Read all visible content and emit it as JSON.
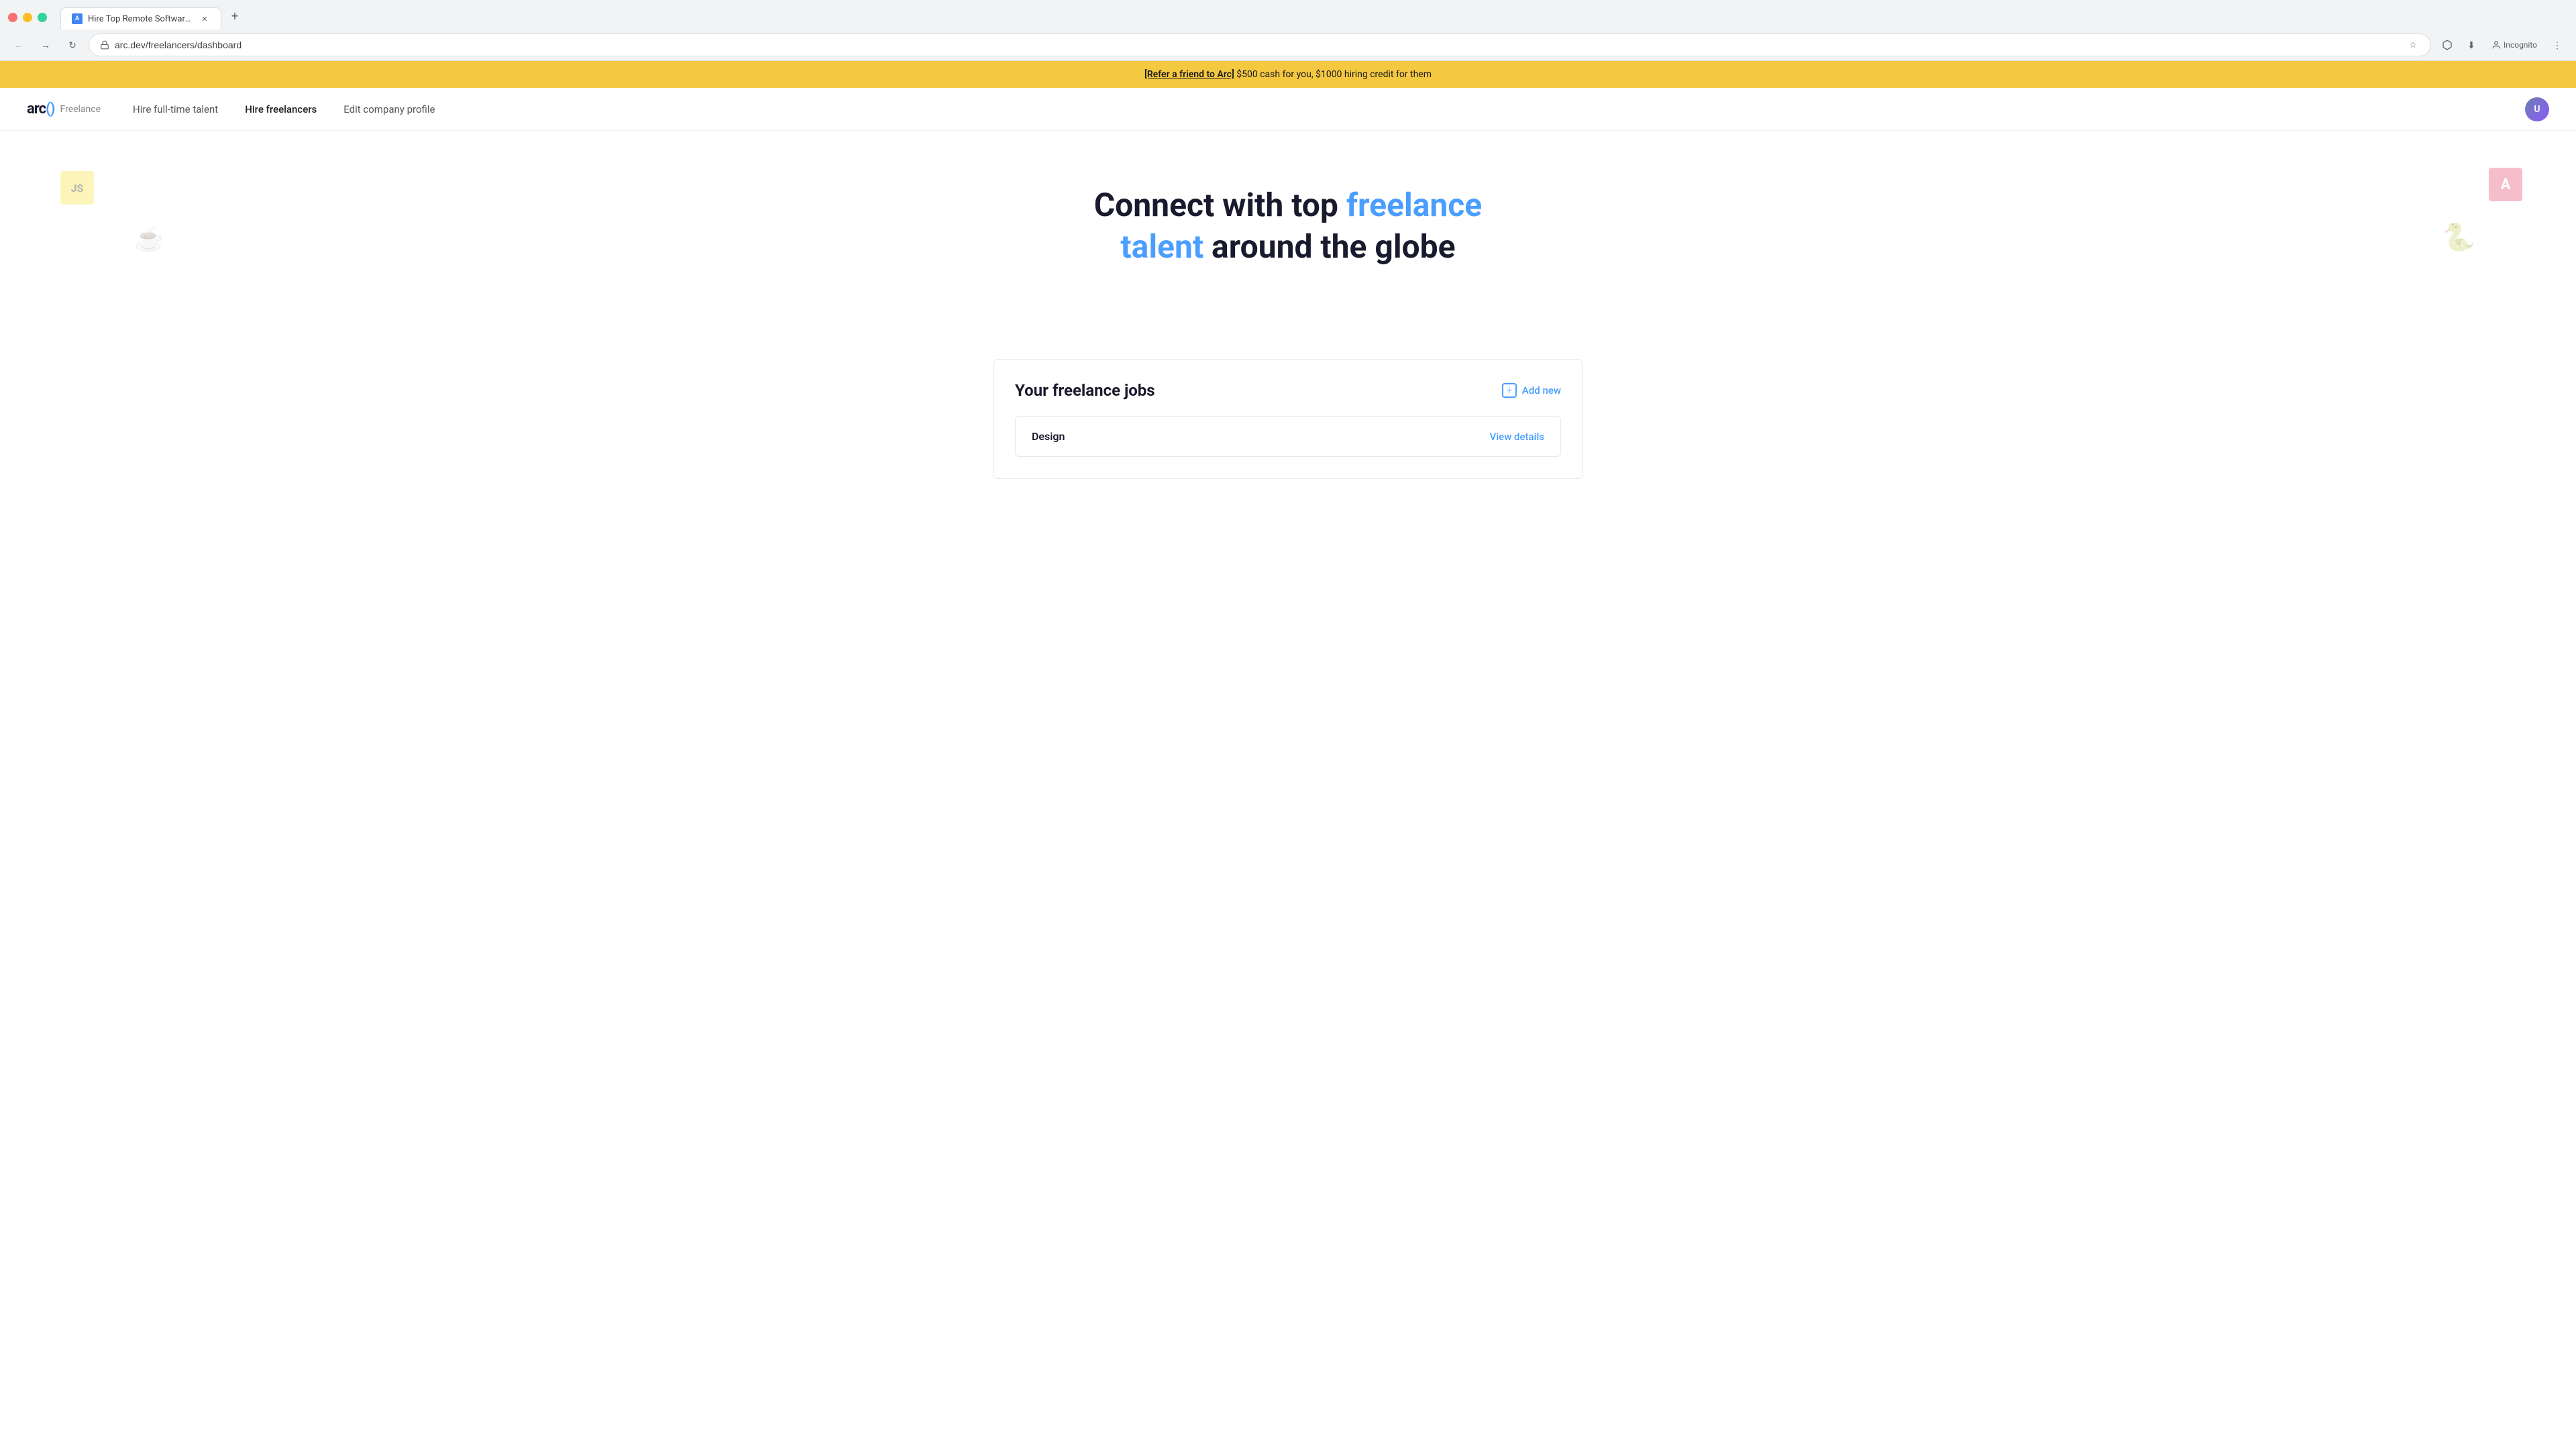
{
  "browser": {
    "tab": {
      "title": "Hire Top Remote Software Dev...",
      "favicon_label": "A"
    },
    "url": "arc.dev/freelancers/dashboard",
    "back_disabled": false,
    "forward_disabled": true,
    "incognito_label": "Incognito",
    "new_tab_symbol": "+"
  },
  "promo_banner": {
    "link_text": "[Refer a friend to Arc]",
    "body_text": " $500 cash for you, $1000 hiring credit for them"
  },
  "nav": {
    "logo_text": "arc()",
    "logo_product": "Freelance",
    "links": [
      {
        "label": "Hire full-time talent",
        "active": false
      },
      {
        "label": "Hire freelancers",
        "active": true
      },
      {
        "label": "Edit company profile",
        "active": false
      }
    ]
  },
  "hero": {
    "title_part1": "Connect with top ",
    "title_highlight": "freelance talent",
    "title_part2": " around the globe",
    "tech_icons": [
      {
        "name": "js",
        "label": "JS"
      },
      {
        "name": "angular",
        "label": "A"
      },
      {
        "name": "java",
        "label": "☕"
      },
      {
        "name": "python",
        "label": "🐍"
      }
    ]
  },
  "jobs_section": {
    "title": "Your freelance jobs",
    "add_new_label": "Add new",
    "jobs": [
      {
        "name": "Design",
        "view_details_label": "View details"
      }
    ]
  }
}
